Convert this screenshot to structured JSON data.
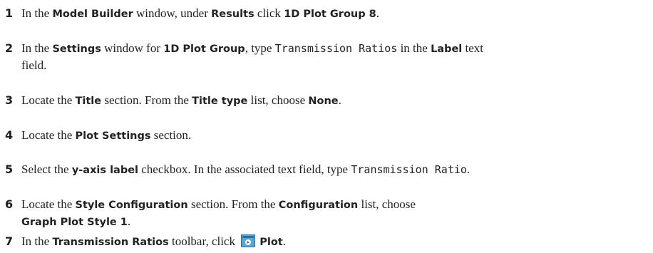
{
  "steps": [
    {
      "number": "1",
      "parts": [
        {
          "t": "In the "
        },
        {
          "b": "Model Builder"
        },
        {
          "t": " window, under "
        },
        {
          "b": "Results"
        },
        {
          "t": " click "
        },
        {
          "b": "1D Plot Group 8"
        },
        {
          "t": "."
        }
      ]
    },
    {
      "number": "2",
      "parts": [
        {
          "t": "In the "
        },
        {
          "b": "Settings"
        },
        {
          "t": " window for "
        },
        {
          "b": "1D Plot Group"
        },
        {
          "t": ", type "
        },
        {
          "m": "Transmission Ratios"
        },
        {
          "t": " in the "
        },
        {
          "b": "Label"
        },
        {
          "t": " text"
        }
      ],
      "continuation": "field."
    },
    {
      "number": "3",
      "parts": [
        {
          "t": "Locate the "
        },
        {
          "b": "Title"
        },
        {
          "t": " section. From the "
        },
        {
          "b": "Title type"
        },
        {
          "t": " list, choose "
        },
        {
          "b": "None"
        },
        {
          "t": "."
        }
      ]
    },
    {
      "number": "4",
      "parts": [
        {
          "t": "Locate the "
        },
        {
          "b": "Plot Settings"
        },
        {
          "t": " section."
        }
      ]
    },
    {
      "number": "5",
      "parts": [
        {
          "t": "Select the "
        },
        {
          "b": "y-axis label"
        },
        {
          "t": " checkbox. In the associated text field, type "
        },
        {
          "m": "Transmission Ratio"
        },
        {
          "t": "."
        }
      ]
    },
    {
      "number": "6",
      "parts": [
        {
          "t": "Locate the "
        },
        {
          "b": "Style Configuration"
        },
        {
          "t": " section. From the "
        },
        {
          "b": "Configuration"
        },
        {
          "t": " list, choose"
        }
      ],
      "continuation_bold": "Graph Plot Style 1",
      "continuation_after": "."
    },
    {
      "number": "7",
      "parts": [
        {
          "t": "In the "
        },
        {
          "b": "Transmission Ratios"
        },
        {
          "t": " toolbar, click "
        },
        {
          "icon": "plot-icon"
        },
        {
          "b": "Plot"
        },
        {
          "t": "."
        }
      ]
    }
  ]
}
